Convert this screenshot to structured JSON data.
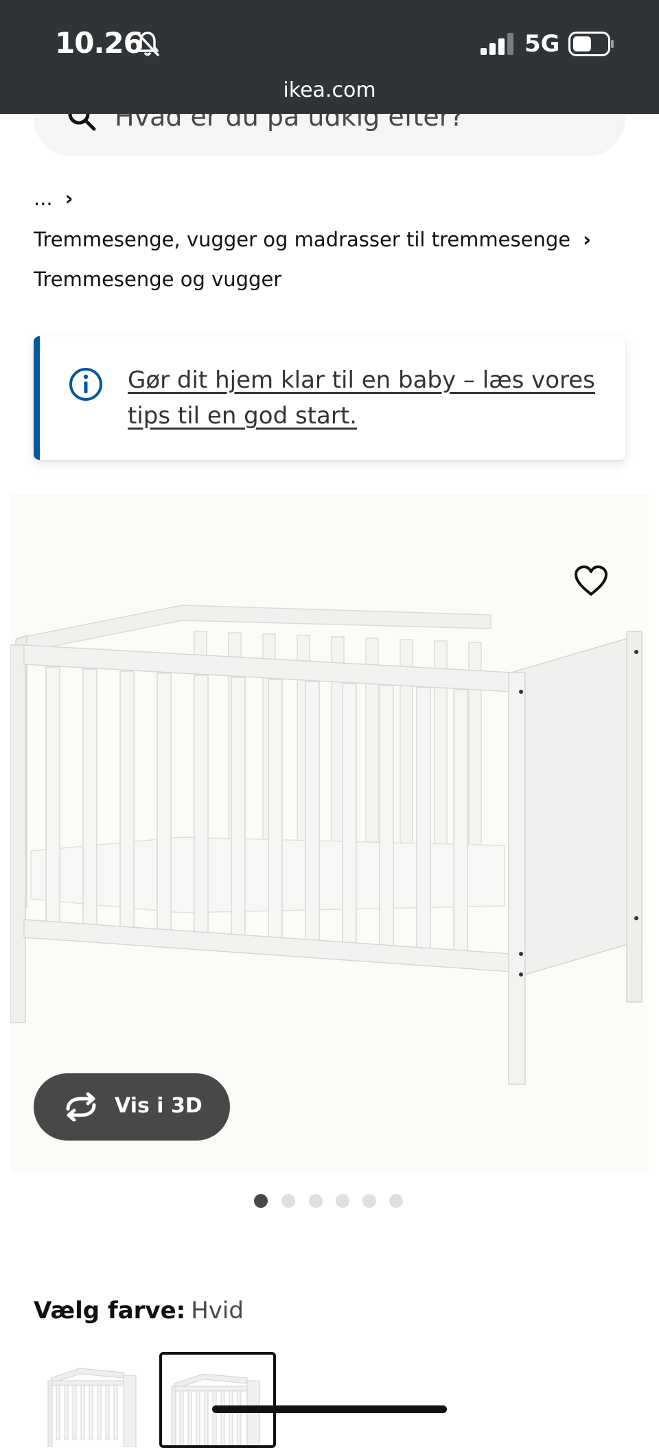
{
  "status_bar": {
    "time": "10.26",
    "network": "5G",
    "domain": "ikea.com"
  },
  "search": {
    "placeholder": "Hvad er du på udkig efter?"
  },
  "breadcrumbs": {
    "ellipsis": "...",
    "category": "Tremmesenge, vugger og madrasser til tremmesenge",
    "current": "Tremmesenge og vugger"
  },
  "banner": {
    "link_text": "Gør dit hjem klar til en baby – læs vores tips til en god start."
  },
  "product": {
    "view_3d_label": "Vis i 3D",
    "carousel": {
      "count": 6,
      "active_index": 0
    }
  },
  "color_select": {
    "label": "Vælg farve:",
    "value": "Hvid"
  },
  "colors": {
    "status_bar_bg": "#303437",
    "accent_blue": "#0058a3",
    "button_dark": "#484848"
  }
}
